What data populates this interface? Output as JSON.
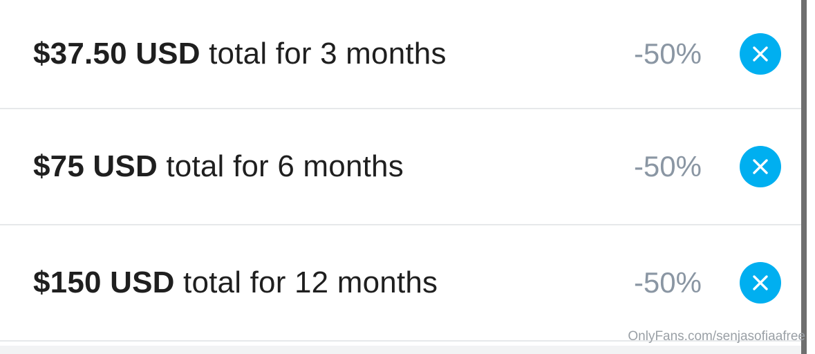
{
  "bundles": [
    {
      "price": "$37.50 USD",
      "description": " total for 3 months",
      "discount": "-50%"
    },
    {
      "price": "$75 USD",
      "description": " total for 6 months",
      "discount": "-50%"
    },
    {
      "price": "$150 USD",
      "description": " total for 12 months",
      "discount": "-50%"
    }
  ],
  "icons": {
    "remove": "close-icon"
  },
  "colors": {
    "accent": "#00aff0",
    "discount": "#8a96a3",
    "text": "#1f1f1f"
  },
  "watermark": "OnlyFans.com/senjasofiaafree"
}
